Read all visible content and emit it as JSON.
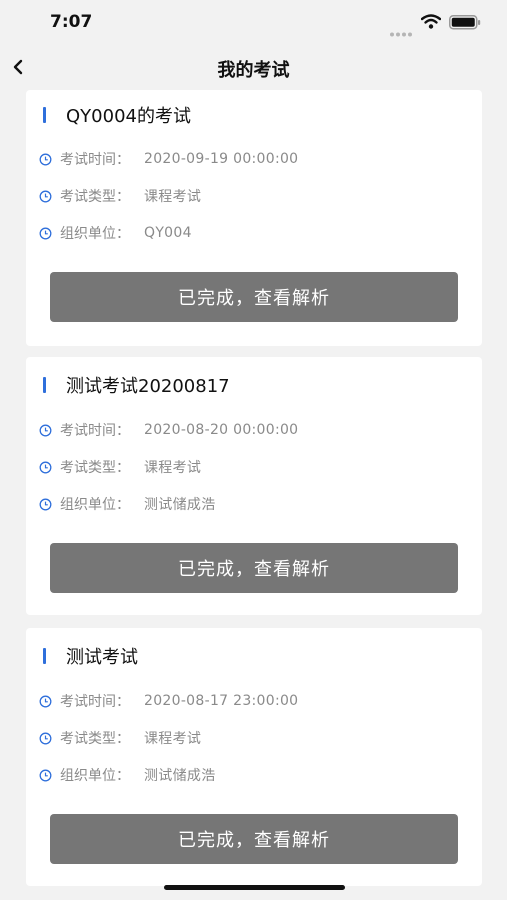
{
  "status_bar": {
    "time": "7:07"
  },
  "nav": {
    "title": "我的考试"
  },
  "exams": [
    {
      "title": "QY0004的考试",
      "rows": [
        {
          "label": "考试时间：",
          "value": "2020-09-19 00:00:00"
        },
        {
          "label": "考试类型：",
          "value": "课程考试"
        },
        {
          "label": "组织单位：",
          "value": "QY004"
        }
      ],
      "action_label": "已完成，查看解析"
    },
    {
      "title": "测试考试20200817",
      "rows": [
        {
          "label": "考试时间：",
          "value": "2020-08-20 00:00:00"
        },
        {
          "label": "考试类型：",
          "value": "课程考试"
        },
        {
          "label": "组织单位：",
          "value": "测试储成浩"
        }
      ],
      "action_label": "已完成，查看解析"
    },
    {
      "title": "测试考试",
      "rows": [
        {
          "label": "考试时间：",
          "value": "2020-08-17 23:00:00"
        },
        {
          "label": "考试类型：",
          "value": "课程考试"
        },
        {
          "label": "组织单位：",
          "value": "测试储成浩"
        }
      ],
      "action_label": "已完成，查看解析"
    }
  ],
  "colors": {
    "accent": "#2f6fdb",
    "button": "#767676",
    "label": "#8a8a8a",
    "background": "#f2f2f2"
  }
}
